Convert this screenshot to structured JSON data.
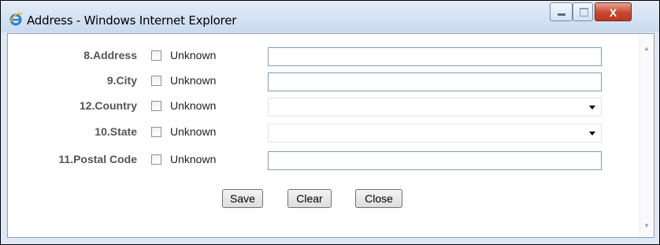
{
  "window": {
    "title": "Address - Windows Internet Explorer",
    "icons": {
      "app": "ie-icon",
      "minimize": "minimize-icon",
      "maximize": "maximize-icon",
      "close": "close-icon"
    },
    "close_glyph": "X"
  },
  "form": {
    "unknown_label": "Unknown",
    "fields": [
      {
        "label": "8.Address",
        "type": "text",
        "value": ""
      },
      {
        "label": "9.City",
        "type": "text",
        "value": ""
      },
      {
        "label": "12.Country",
        "type": "select",
        "value": ""
      },
      {
        "label": "10.State",
        "type": "select",
        "value": ""
      },
      {
        "label": "11.Postal Code",
        "type": "text",
        "value": ""
      }
    ],
    "buttons": {
      "save": "Save",
      "clear": "Clear",
      "close": "Close"
    }
  }
}
